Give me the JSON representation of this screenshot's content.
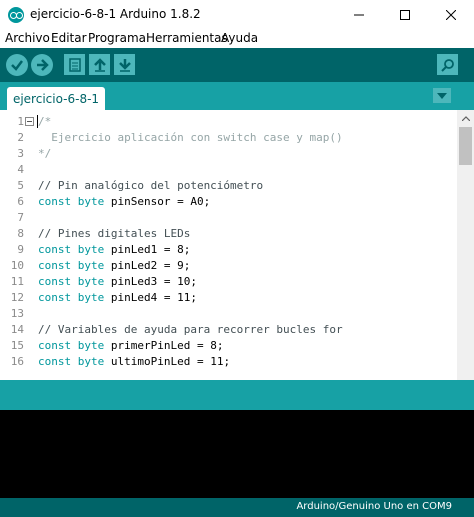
{
  "window": {
    "title": "ejercicio-6-8-1 Arduino 1.8.2"
  },
  "menu": {
    "items": [
      "Archivo",
      "Editar",
      "Programa",
      "Herramientas",
      "Ayuda"
    ]
  },
  "toolbar": {
    "buttons": [
      "verify-icon",
      "upload-icon",
      "new-icon",
      "open-icon",
      "save-icon",
      "serial-monitor-icon"
    ]
  },
  "tabs": {
    "active": "ejercicio-6-8-1"
  },
  "editor": {
    "line_numbers": [
      "1",
      "2",
      "3",
      "4",
      "5",
      "6",
      "7",
      "8",
      "9",
      "10",
      "11",
      "12",
      "13",
      "14",
      "15",
      "16"
    ],
    "lines": {
      "l1": "/*",
      "l2": "  Ejercicio aplicación con switch case y map()",
      "l3": "*/",
      "l5": "// Pin analógico del potenciómetro",
      "l6_kw": "const byte",
      "l6_rest": " pinSensor = A0;",
      "l8": "// Pines digitales LEDs",
      "l9_kw": "const byte",
      "l9_rest": " pinLed1 = 8;",
      "l10_kw": "const byte",
      "l10_rest": " pinLed2 = 9;",
      "l11_kw": "const byte",
      "l11_rest": " pinLed3 = 10;",
      "l12_kw": "const byte",
      "l12_rest": " pinLed4 = 11;",
      "l14": "// Variables de ayuda para recorrer bucles for",
      "l15_kw": "const byte",
      "l15_rest": " primerPinLed = 8;",
      "l16_kw": "const byte",
      "l16_rest": " ultimoPinLed = 11;"
    }
  },
  "status": {
    "board": "Arduino/Genuino Uno en COM9"
  },
  "colors": {
    "toolbar": "#006468",
    "tabbar": "#17a1a5",
    "button": "#4db7bb",
    "keyword": "#00979c",
    "comment": "#95a5a6"
  }
}
